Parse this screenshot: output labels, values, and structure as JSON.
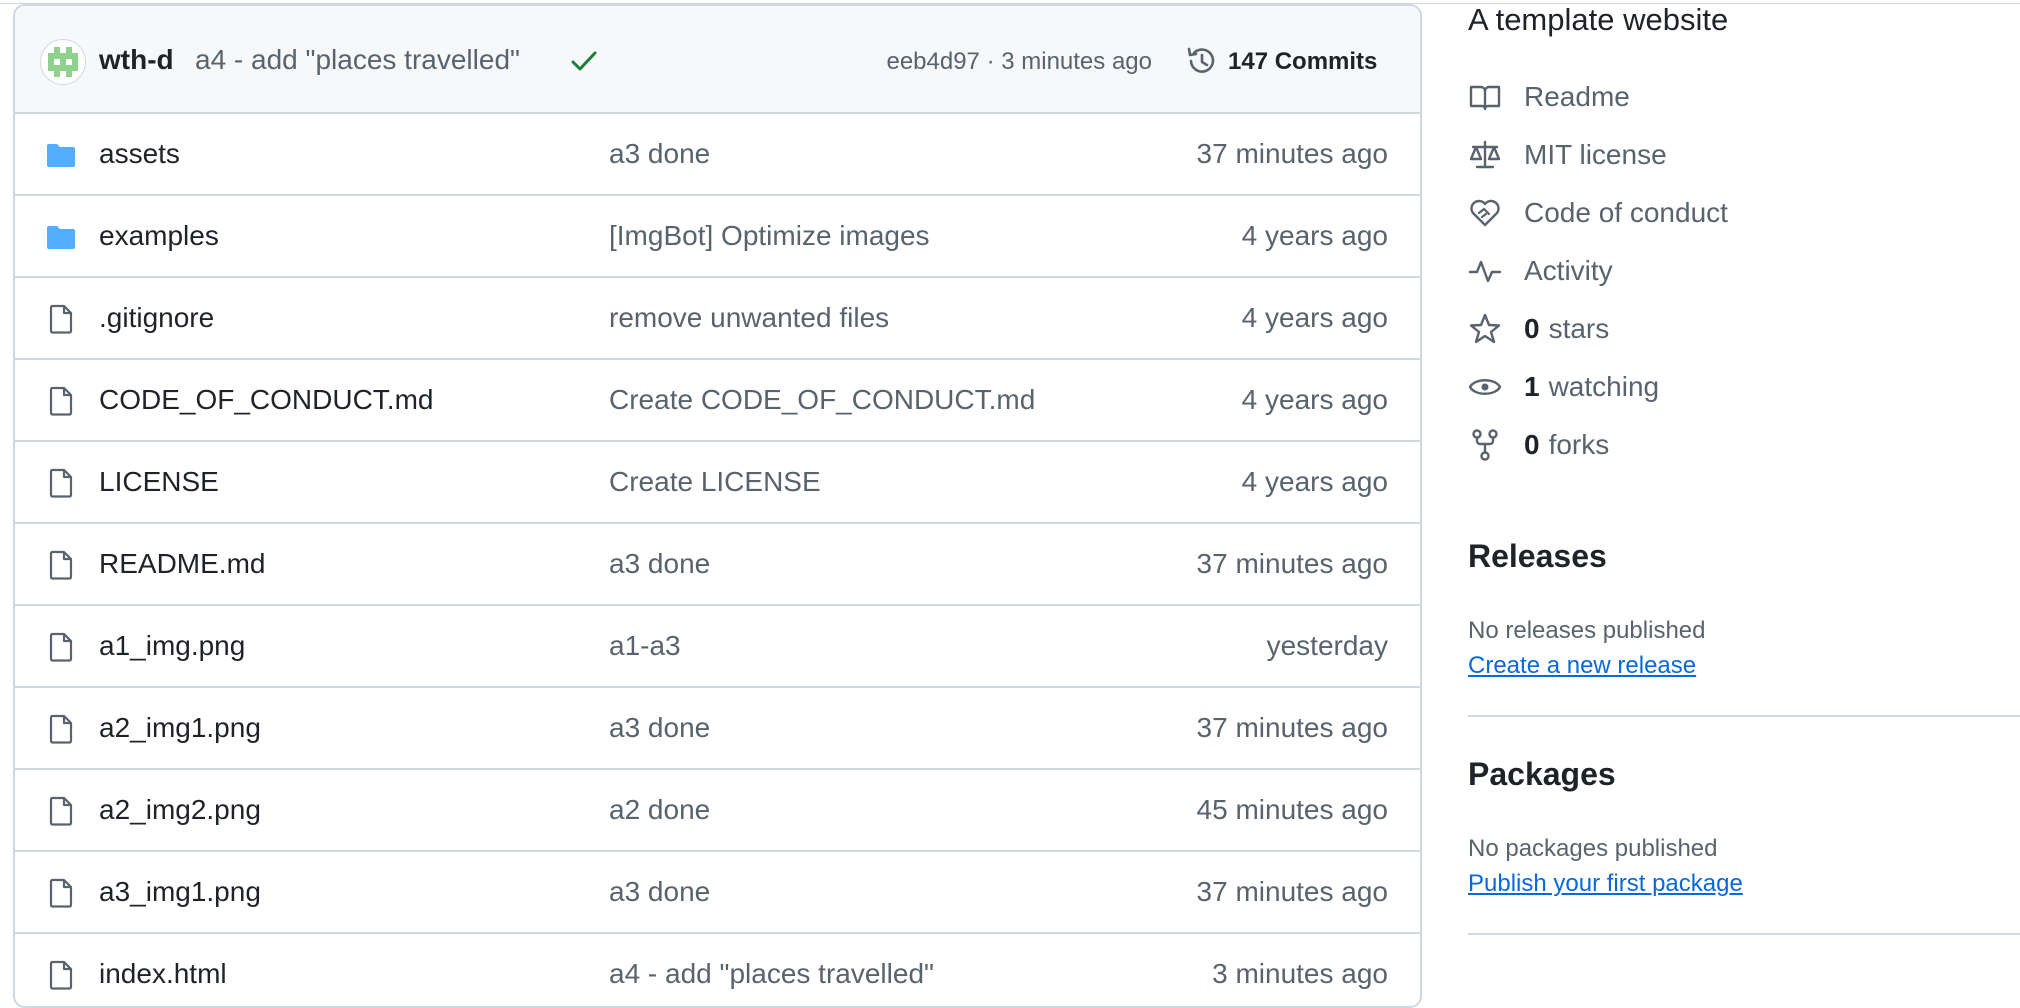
{
  "latest_commit": {
    "author": "wth-d",
    "message": "a4 - add \"places travelled\"",
    "meta": "eeb4d97 · 3 minutes ago",
    "commits_count": "147 Commits"
  },
  "files": [
    {
      "type": "folder",
      "name": "assets",
      "message": "a3 done",
      "age": "37 minutes ago"
    },
    {
      "type": "folder",
      "name": "examples",
      "message": "[ImgBot] Optimize images",
      "age": "4 years ago"
    },
    {
      "type": "file",
      "name": ".gitignore",
      "message": "remove unwanted files",
      "age": "4 years ago"
    },
    {
      "type": "file",
      "name": "CODE_OF_CONDUCT.md",
      "message": "Create CODE_OF_CONDUCT.md",
      "age": "4 years ago"
    },
    {
      "type": "file",
      "name": "LICENSE",
      "message": "Create LICENSE",
      "age": "4 years ago"
    },
    {
      "type": "file",
      "name": "README.md",
      "message": "a3 done",
      "age": "37 minutes ago"
    },
    {
      "type": "file",
      "name": "a1_img.png",
      "message": "a1-a3",
      "age": "yesterday"
    },
    {
      "type": "file",
      "name": "a2_img1.png",
      "message": "a3 done",
      "age": "37 minutes ago"
    },
    {
      "type": "file",
      "name": "a2_img2.png",
      "message": "a2 done",
      "age": "45 minutes ago"
    },
    {
      "type": "file",
      "name": "a3_img1.png",
      "message": "a3 done",
      "age": "37 minutes ago"
    },
    {
      "type": "file",
      "name": "index.html",
      "message": "a4 - add \"places travelled\"",
      "age": "3 minutes ago"
    }
  ],
  "about": {
    "description": "A template website",
    "readme": "Readme",
    "license": "MIT license",
    "code_of_conduct": "Code of conduct",
    "activity": "Activity",
    "stars_count": "0",
    "stars_label": "stars",
    "watching_count": "1",
    "watching_label": "watching",
    "forks_count": "0",
    "forks_label": "forks"
  },
  "releases": {
    "title": "Releases",
    "empty": "No releases published",
    "link": "Create a new release"
  },
  "packages": {
    "title": "Packages",
    "empty": "No packages published",
    "link": "Publish your first package"
  },
  "colors": {
    "folder": "#54aeff",
    "check": "#1a7f37",
    "link": "#0969da",
    "muted": "#59636e",
    "border": "#d0d7de"
  }
}
